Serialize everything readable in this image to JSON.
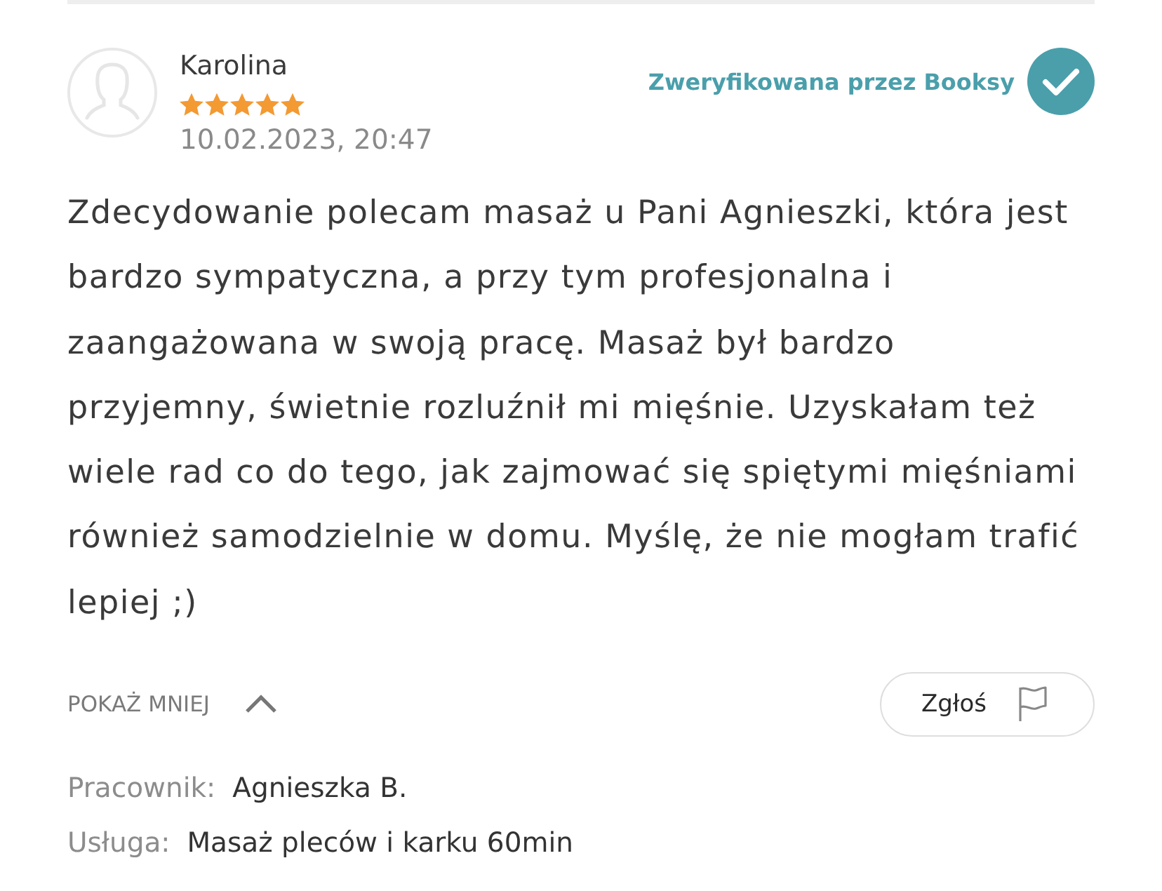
{
  "review": {
    "author": "Karolina",
    "stars": 5,
    "date": "10.02.2023, 20:47",
    "verified_label": "Zweryfikowana przez Booksy",
    "text": "Zdecydowanie polecam masaż u Pani Agnieszki, która jest bardzo sympatyczna, a przy tym profesjonalna i zaangażowana w swoją pracę. Masaż był bardzo przyjemny, świetnie rozluźnił mi mięśnie. Uzyskałam też wiele rad co do tego, jak zajmować się spiętymi mięśniami również samodzielnie w domu. Myślę, że nie mogłam trafić lepiej ;)",
    "toggle": {
      "label": "POKAŻ MNIEJ",
      "expanded": true
    },
    "report_button": "Zgłoś",
    "details": [
      {
        "label": "Pracownik:",
        "value": "Agnieszka B."
      },
      {
        "label": "Usługa:",
        "value": "Masaż pleców i karku 60min"
      }
    ]
  }
}
